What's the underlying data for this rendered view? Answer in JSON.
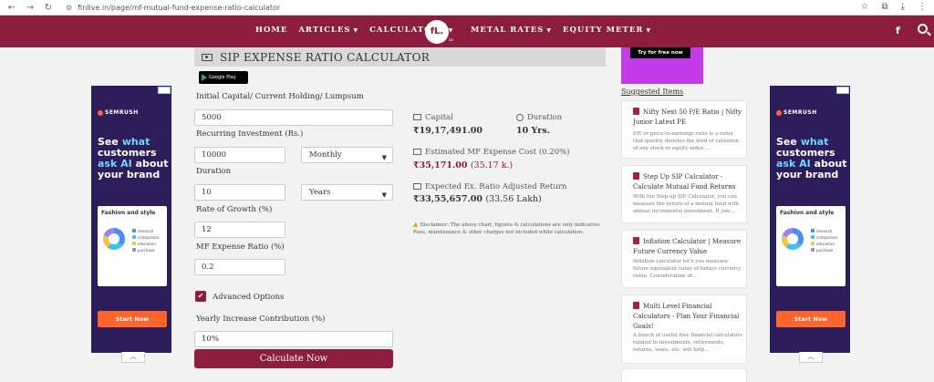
{
  "browser": {
    "url": "finlive.in/page/mf-mutual-fund-expense-ratio-calculator"
  },
  "navbar": {
    "items_left": [
      "HOME",
      "ARTICLES",
      "CALCULATORS"
    ],
    "items_right": [
      "METAL RATES",
      "EQUITY METER"
    ],
    "logo_text": "fL.",
    "logo_suffix": "in",
    "facebook": "f"
  },
  "calculator": {
    "title": "SIP EXPENSE RATIO CALCULATOR",
    "google_play": "Google Play",
    "initial_capital_label": "Initial Capital/ Current Holding/ Lumpsum",
    "initial_capital_value": "5000",
    "recurring_label": "Recurring Investment (Rs.)",
    "recurring_value": "10000",
    "recurring_frequency": "Monthly",
    "duration_label": "Duration",
    "duration_value": "10",
    "duration_unit": "Years",
    "growth_label": "Rate of Growth (%)",
    "growth_value": "12",
    "expense_label": "MF Expense Ratio (%)",
    "expense_value": "0.2",
    "advanced_label": "Advanced Options",
    "yearly_increase_label": "Yearly Increase Contribution (%)",
    "yearly_increase_value": "10%",
    "calculate_label": "Calculate Now"
  },
  "results": {
    "capital_label": "Capital",
    "capital_value": "₹19,17,491.00",
    "duration_label": "Duration",
    "duration_value": "10 Yrs.",
    "expense_label": "Estimated MF Expense Cost (0.20%)",
    "expense_value": "₹35,171.00",
    "expense_sub": "(35.17 k.)",
    "return_label": "Expected Ex. Ratio Adjusted Return",
    "return_value": "₹33,55,657.00",
    "return_sub": "(33.56 Lakh)",
    "disclaimer": "Disclaimer: The above chart, figures & calculations are only indicative. Fees, maintenance & other charges not included while calculation."
  },
  "ads": {
    "brand": "SEMRUSH",
    "line1": "See ",
    "line1_hl": "what",
    "line2": "customers",
    "line3": "ask AI",
    "line3_rest": " about",
    "line4": "your brand",
    "card_title": "Fashion and style",
    "card_legend": [
      "research",
      "comparison",
      "education",
      "purchase"
    ],
    "cta": "Start Now"
  },
  "sidebar": {
    "try_label": "Try for free now",
    "suggested_title": "Suggested Items",
    "items": [
      {
        "title": "Nifty Next 50 P/E Ratio | Nifty Junior Latest PE",
        "desc": "P/E or price-to-earnings ratio is a value that quickly denotes the kind of valuation of any stock or equity index, ..."
      },
      {
        "title": "Step Up SIP Calculator - Calculate Mutual Fund Returns",
        "desc": "With the Step-up SIP Calculator, you can measure the return of a mutual fund with annual incremental investment. If you..."
      },
      {
        "title": "Inflation Calculator | Measure Future Currency Value",
        "desc": "Inflation calculator let's you measure future equivalent value of todays currency value. Consideration of..."
      },
      {
        "title": "Multi Level Financial Calculators - Plan Your Financial Goals!",
        "desc": "A bunch of useful free financial calculators related to investments, retirements, returns, loans, etc. will help..."
      }
    ]
  },
  "colors": {
    "brand": "#8c1d3c",
    "ad_bg": "#2d1d5a",
    "ad_cta": "#ff642d"
  }
}
